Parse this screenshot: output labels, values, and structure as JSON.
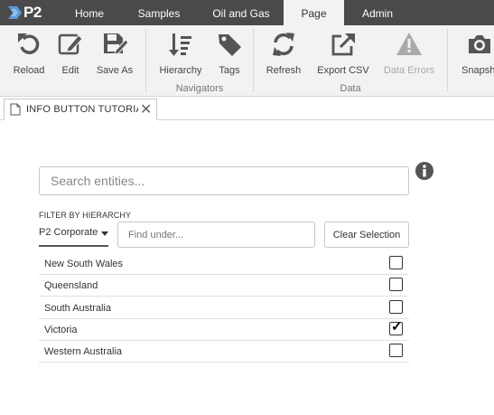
{
  "app": {
    "logo_text": "P2"
  },
  "nav": {
    "tabs": [
      {
        "label": "Home",
        "active": false
      },
      {
        "label": "Samples",
        "active": false
      },
      {
        "label": "Oil and Gas",
        "active": false
      },
      {
        "label": "Page",
        "active": true
      },
      {
        "label": "Admin",
        "active": false
      }
    ]
  },
  "ribbon": {
    "buttons": [
      {
        "label": "Reload",
        "icon": "reload-icon",
        "enabled": true
      },
      {
        "label": "Edit",
        "icon": "edit-icon",
        "enabled": true
      },
      {
        "label": "Save As",
        "icon": "save-as-icon",
        "enabled": true
      },
      {
        "label": "Hierarchy",
        "icon": "hierarchy-icon",
        "enabled": true
      },
      {
        "label": "Tags",
        "icon": "tag-icon",
        "enabled": true
      },
      {
        "label": "Refresh",
        "icon": "refresh-icon",
        "enabled": true
      },
      {
        "label": "Export CSV",
        "icon": "export-icon",
        "enabled": true
      },
      {
        "label": "Data Errors",
        "icon": "warning-icon",
        "enabled": false
      },
      {
        "label": "Snapshot",
        "icon": "camera-icon",
        "enabled": true
      }
    ],
    "groups": [
      {
        "label": "Navigators"
      },
      {
        "label": "Data"
      }
    ]
  },
  "doc_tab": {
    "title": "INFO BUTTON TUTORIAL"
  },
  "search": {
    "placeholder": "Search entities..."
  },
  "filter": {
    "label": "FILTER BY HIERARCHY",
    "hierarchy_value": "P2 Corporate",
    "find_placeholder": "Find under...",
    "clear_label": "Clear Selection"
  },
  "entities": [
    {
      "name": "New South Wales",
      "checked": false
    },
    {
      "name": "Queensland",
      "checked": false
    },
    {
      "name": "South Australia",
      "checked": false
    },
    {
      "name": "Victoria",
      "checked": true
    },
    {
      "name": "Western Australia",
      "checked": false
    }
  ],
  "colors": {
    "topbar": "#4a4a4a",
    "ribbon": "#f2f2f2",
    "icon": "#555555",
    "logo_accent": "#5b9bd5"
  }
}
